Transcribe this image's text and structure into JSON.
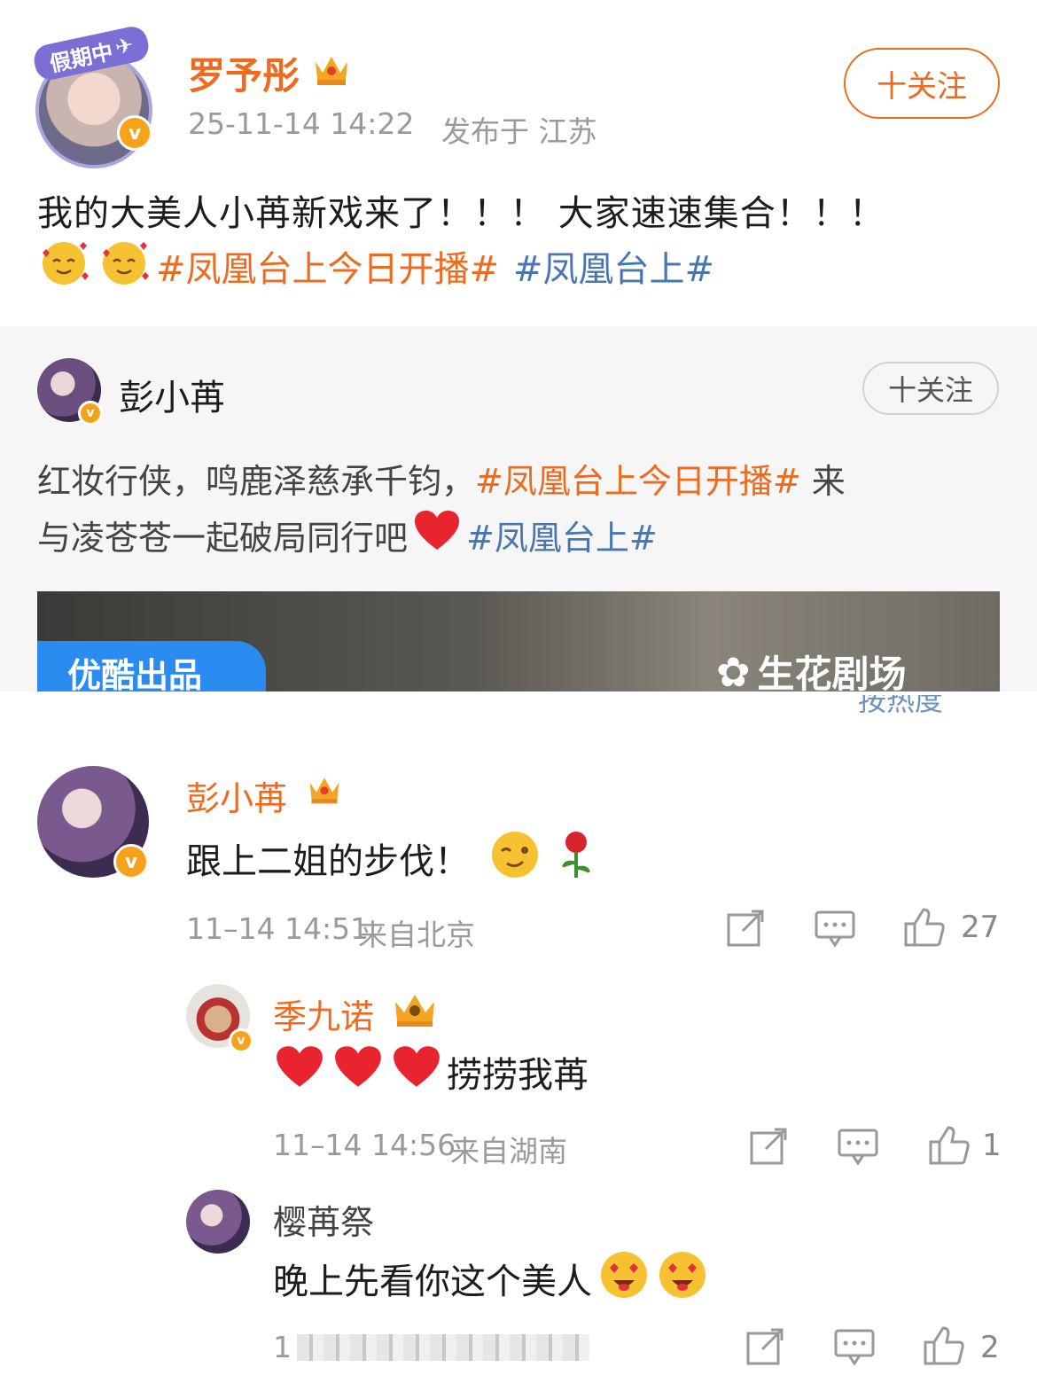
{
  "post": {
    "badge_text": "假期中",
    "author": "罗予彤",
    "time": "25-11-14 14:22",
    "location": "发布于 江苏",
    "follow_label": "十关注",
    "text_line1": "我的大美人小苒新戏来了！！！ 大家速速集合！！！",
    "hashtag1": "#凤凰台上今日开播#",
    "hashtag2": "#凤凰台上#"
  },
  "repost": {
    "author": "彭小苒",
    "follow_label": "十关注",
    "text_part1": "红妆行侠，鸣鹿泽慈承千钧，",
    "hashtag1": "#凤凰台上今日开播#",
    "text_part2": " 来",
    "text_line2": "与凌苍苍一起破局同行吧",
    "hashtag2": "#凤凰台上#",
    "banner_left": "优酷出品",
    "banner_right": "生花剧场"
  },
  "sort_label": "按热度",
  "comments": [
    {
      "author": "彭小苒",
      "text": "跟上二姐的步伐！",
      "time": "11–14 14:51",
      "location": "来自北京",
      "likes": "27"
    },
    {
      "author": "季九诺",
      "text": "捞捞我苒",
      "time": "11–14 14:56",
      "location": "来自湖南",
      "likes": "1"
    },
    {
      "author": "樱苒祭",
      "text": "晚上先看你这个美人",
      "time": "1",
      "likes": "2"
    }
  ],
  "colors": {
    "accent": "#ee6a1f",
    "link": "#4a76b0",
    "verified": "#f6a21a"
  }
}
